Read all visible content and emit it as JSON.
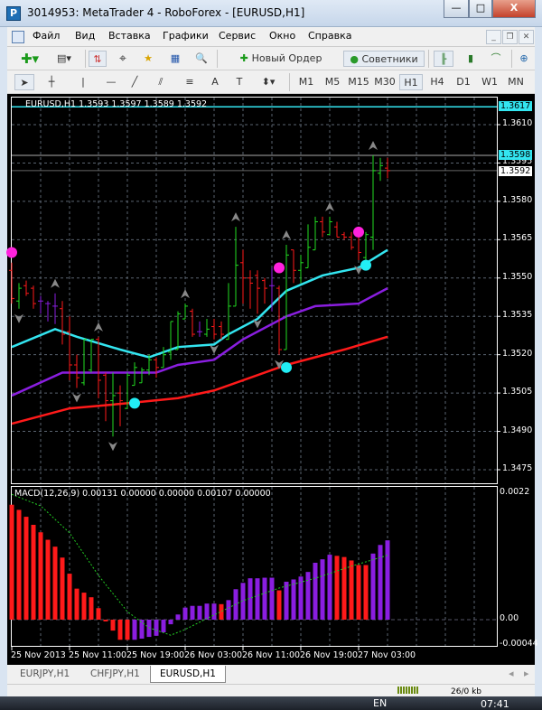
{
  "window": {
    "title": "3014953: MetaTrader 4 - RoboForex - [EURUSD,H1]",
    "minimize": "—",
    "maximize": "□",
    "close": "X"
  },
  "menu": [
    "Файл",
    "Вид",
    "Вставка",
    "Графики",
    "Сервис",
    "Окно",
    "Справка"
  ],
  "toolbar": {
    "new_order": "Новый Ордер",
    "experts": "Советники"
  },
  "timeframes": [
    "M1",
    "M5",
    "M15",
    "M30",
    "H1",
    "H4",
    "D1",
    "W1",
    "MN"
  ],
  "active_timeframe": "H1",
  "chart": {
    "header": "EURUSD,H1  1.3593 1.3597 1.3589 1.3592",
    "price_ticks": [
      "1.3610",
      "1.3595",
      "1.3580",
      "1.3565",
      "1.3550",
      "1.3535",
      "1.3520",
      "1.3505",
      "1.3490",
      "1.3475"
    ],
    "label_top": "1.3617",
    "label_high": "1.3598",
    "label_bid": "1.3592",
    "time_labels": [
      "25 Nov 2013",
      "25 Nov 11:00",
      "25 Nov 19:00",
      "26 Nov 03:00",
      "26 Nov 11:00",
      "26 Nov 19:00",
      "27 Nov 03:00"
    ],
    "colors": {
      "up": "#22dd22",
      "down": "#ff1a1a",
      "doji": "#8a1ee0",
      "ma_fast": "#33e5f0",
      "ma_mid": "#8a1ee0",
      "ma_slow": "#ff1a1a",
      "dot_sell": "#ff22dd",
      "dot_buy": "#22eef5"
    }
  },
  "chart_data": [
    {
      "type": "ohlc",
      "symbol": "EURUSD",
      "timeframe": "H1",
      "ylim": [
        1.347,
        1.362
      ],
      "bars": [
        [
          1.3553,
          1.3556,
          1.354,
          1.3542
        ],
        [
          1.3541,
          1.3548,
          1.3538,
          1.3546
        ],
        [
          1.3547,
          1.3549,
          1.3543,
          1.3544
        ],
        [
          1.3546,
          1.3547,
          1.3538,
          1.354
        ],
        [
          1.3541,
          1.3543,
          1.3536,
          1.3541
        ],
        [
          1.354,
          1.3541,
          1.3533,
          1.354
        ],
        [
          1.3539,
          1.3544,
          1.3532,
          1.3539
        ],
        [
          1.3538,
          1.3541,
          1.3524,
          1.3528
        ],
        [
          1.3529,
          1.3535,
          1.351,
          1.3516
        ],
        [
          1.3516,
          1.352,
          1.3507,
          1.3511
        ],
        [
          1.3509,
          1.3526,
          1.3508,
          1.3526
        ],
        [
          1.3514,
          1.3526,
          1.3513,
          1.3526
        ],
        [
          1.3526,
          1.3527,
          1.3503,
          1.351
        ],
        [
          1.3512,
          1.3513,
          1.3494,
          1.3502
        ],
        [
          1.3502,
          1.3513,
          1.3488,
          1.3504
        ],
        [
          1.3505,
          1.3508,
          1.3492,
          1.3502
        ],
        [
          1.3499,
          1.3513,
          1.3499,
          1.3512
        ],
        [
          1.3508,
          1.3517,
          1.3508,
          1.3515
        ],
        [
          1.3509,
          1.3515,
          1.3509,
          1.3514
        ],
        [
          1.3514,
          1.352,
          1.3512,
          1.3518
        ],
        [
          1.3518,
          1.3519,
          1.3511,
          1.3515
        ],
        [
          1.3515,
          1.3523,
          1.3515,
          1.352
        ],
        [
          1.3521,
          1.3533,
          1.3518,
          1.3533
        ],
        [
          1.3522,
          1.3537,
          1.3522,
          1.3536
        ],
        [
          1.3534,
          1.354,
          1.3534,
          1.3539
        ],
        [
          1.3537,
          1.3538,
          1.3527,
          1.3528
        ],
        [
          1.3529,
          1.3533,
          1.3527,
          1.3529
        ],
        [
          1.3528,
          1.3534,
          1.3527,
          1.353
        ],
        [
          1.3531,
          1.3534,
          1.3526,
          1.3528
        ],
        [
          1.3531,
          1.3533,
          1.3526,
          1.3528
        ],
        [
          1.3526,
          1.3548,
          1.3526,
          1.3539
        ],
        [
          1.3539,
          1.357,
          1.3539,
          1.3555
        ],
        [
          1.3556,
          1.3561,
          1.354,
          1.355
        ],
        [
          1.355,
          1.3553,
          1.3538,
          1.3548
        ],
        [
          1.3551,
          1.3553,
          1.3536,
          1.3546
        ],
        [
          1.3549,
          1.355,
          1.354,
          1.3546
        ],
        [
          1.3547,
          1.3554,
          1.3537,
          1.3547
        ],
        [
          1.3546,
          1.3547,
          1.352,
          1.3522
        ],
        [
          1.3522,
          1.3563,
          1.3522,
          1.3559
        ],
        [
          1.3561,
          1.3561,
          1.3548,
          1.3553
        ],
        [
          1.3553,
          1.3559,
          1.3548,
          1.3556
        ],
        [
          1.3554,
          1.3571,
          1.3554,
          1.3562
        ],
        [
          1.3561,
          1.3574,
          1.3561,
          1.3572
        ],
        [
          1.3572,
          1.3574,
          1.3566,
          1.3568
        ],
        [
          1.3567,
          1.3574,
          1.3567,
          1.3572
        ],
        [
          1.357,
          1.3572,
          1.3566,
          1.3566
        ],
        [
          1.3567,
          1.3568,
          1.3565,
          1.3566
        ],
        [
          1.3566,
          1.3568,
          1.3561,
          1.3562
        ],
        [
          1.3567,
          1.3569,
          1.3557,
          1.356
        ],
        [
          1.3558,
          1.3568,
          1.3557,
          1.3567
        ],
        [
          1.3566,
          1.3598,
          1.3561,
          1.3592
        ],
        [
          1.3591,
          1.3597,
          1.3588,
          1.3594
        ],
        [
          1.3593,
          1.3597,
          1.3589,
          1.3592
        ]
      ],
      "ma_fast": [
        [
          0,
          1.3523
        ],
        [
          6,
          1.353
        ],
        [
          9,
          1.3527
        ],
        [
          15,
          1.3522
        ],
        [
          19,
          1.3519
        ],
        [
          23,
          1.3523
        ],
        [
          28,
          1.3524
        ],
        [
          30,
          1.3528
        ],
        [
          34,
          1.3534
        ],
        [
          38,
          1.3545
        ],
        [
          43,
          1.3551
        ],
        [
          48,
          1.3554
        ],
        [
          52,
          1.3561
        ]
      ],
      "ma_mid": [
        [
          0,
          1.3504
        ],
        [
          7,
          1.3513
        ],
        [
          10,
          1.3513
        ],
        [
          16,
          1.3513
        ],
        [
          20,
          1.3513
        ],
        [
          23,
          1.3516
        ],
        [
          28,
          1.3518
        ],
        [
          32,
          1.3526
        ],
        [
          38,
          1.3535
        ],
        [
          42,
          1.3539
        ],
        [
          48,
          1.354
        ],
        [
          52,
          1.3546
        ]
      ],
      "ma_slow": [
        [
          0,
          1.3493
        ],
        [
          8,
          1.3499
        ],
        [
          16,
          1.3501
        ],
        [
          23,
          1.3503
        ],
        [
          28,
          1.3506
        ],
        [
          38,
          1.3516
        ],
        [
          46,
          1.3522
        ],
        [
          52,
          1.3527
        ]
      ],
      "arrows_up": [
        6,
        12,
        24,
        31,
        38,
        44,
        50
      ],
      "arrows_down": [
        1,
        9,
        14,
        28,
        34,
        37,
        48
      ],
      "dots_sell": [
        [
          0,
          1.356
        ],
        [
          37,
          1.3554
        ],
        [
          48,
          1.3568
        ]
      ],
      "dots_buy": [
        [
          17,
          1.3501
        ],
        [
          38,
          1.3515
        ],
        [
          49,
          1.3555
        ]
      ],
      "hlines": [
        1.3617,
        1.3598,
        1.3592
      ]
    },
    {
      "type": "bar",
      "title": "MACD(12,26,9) 0.00131 0.00000 0.00000 0.00107 0.00000",
      "ylim": [
        -0.00044,
        0.0022
      ],
      "y_ticks": [
        "0.0022",
        "0.00",
        "-0.00044"
      ],
      "histogram": [
        0.002,
        0.00191,
        0.00179,
        0.00165,
        0.00152,
        0.00139,
        0.00127,
        0.00108,
        0.0008,
        0.00054,
        0.00047,
        0.00039,
        0.0002,
        -3e-05,
        -0.00019,
        -0.00035,
        -0.00035,
        -0.00035,
        -0.00033,
        -0.0003,
        -0.00028,
        -0.00022,
        -8e-05,
        9e-05,
        0.00021,
        0.00024,
        0.00024,
        0.00028,
        0.00028,
        0.00027,
        0.00034,
        0.00053,
        0.00064,
        0.00072,
        0.00072,
        0.00073,
        0.00073,
        0.00051,
        0.00066,
        0.0007,
        0.00075,
        0.00083,
        0.00099,
        0.00105,
        0.00113,
        0.00111,
        0.00109,
        0.00103,
        0.00095,
        0.00095,
        0.00115,
        0.0013,
        0.00138
      ],
      "red_bars": [
        0,
        1,
        2,
        3,
        4,
        5,
        6,
        7,
        8,
        9,
        10,
        11,
        12,
        13,
        14,
        15,
        16,
        29,
        37,
        45,
        46,
        47,
        48,
        49
      ],
      "signal": [
        [
          0,
          0.00218
        ],
        [
          4,
          0.00198
        ],
        [
          8,
          0.00151
        ],
        [
          12,
          0.00077
        ],
        [
          16,
          0.00014
        ],
        [
          19,
          -0.00014
        ],
        [
          22,
          -0.00027
        ],
        [
          24,
          -0.00017
        ],
        [
          27,
          2e-05
        ],
        [
          32,
          0.00033
        ],
        [
          37,
          0.00055
        ],
        [
          42,
          0.00072
        ],
        [
          47,
          0.00093
        ],
        [
          52,
          0.00112
        ]
      ]
    }
  ],
  "tabs": [
    "EURJPY,H1",
    "CHFJPY,H1",
    "EURUSD,H1"
  ],
  "active_tab": "EURUSD,H1",
  "status": {
    "traffic": "26/0 kb"
  },
  "taskbar": {
    "lang": "EN",
    "clock": "07:41"
  }
}
